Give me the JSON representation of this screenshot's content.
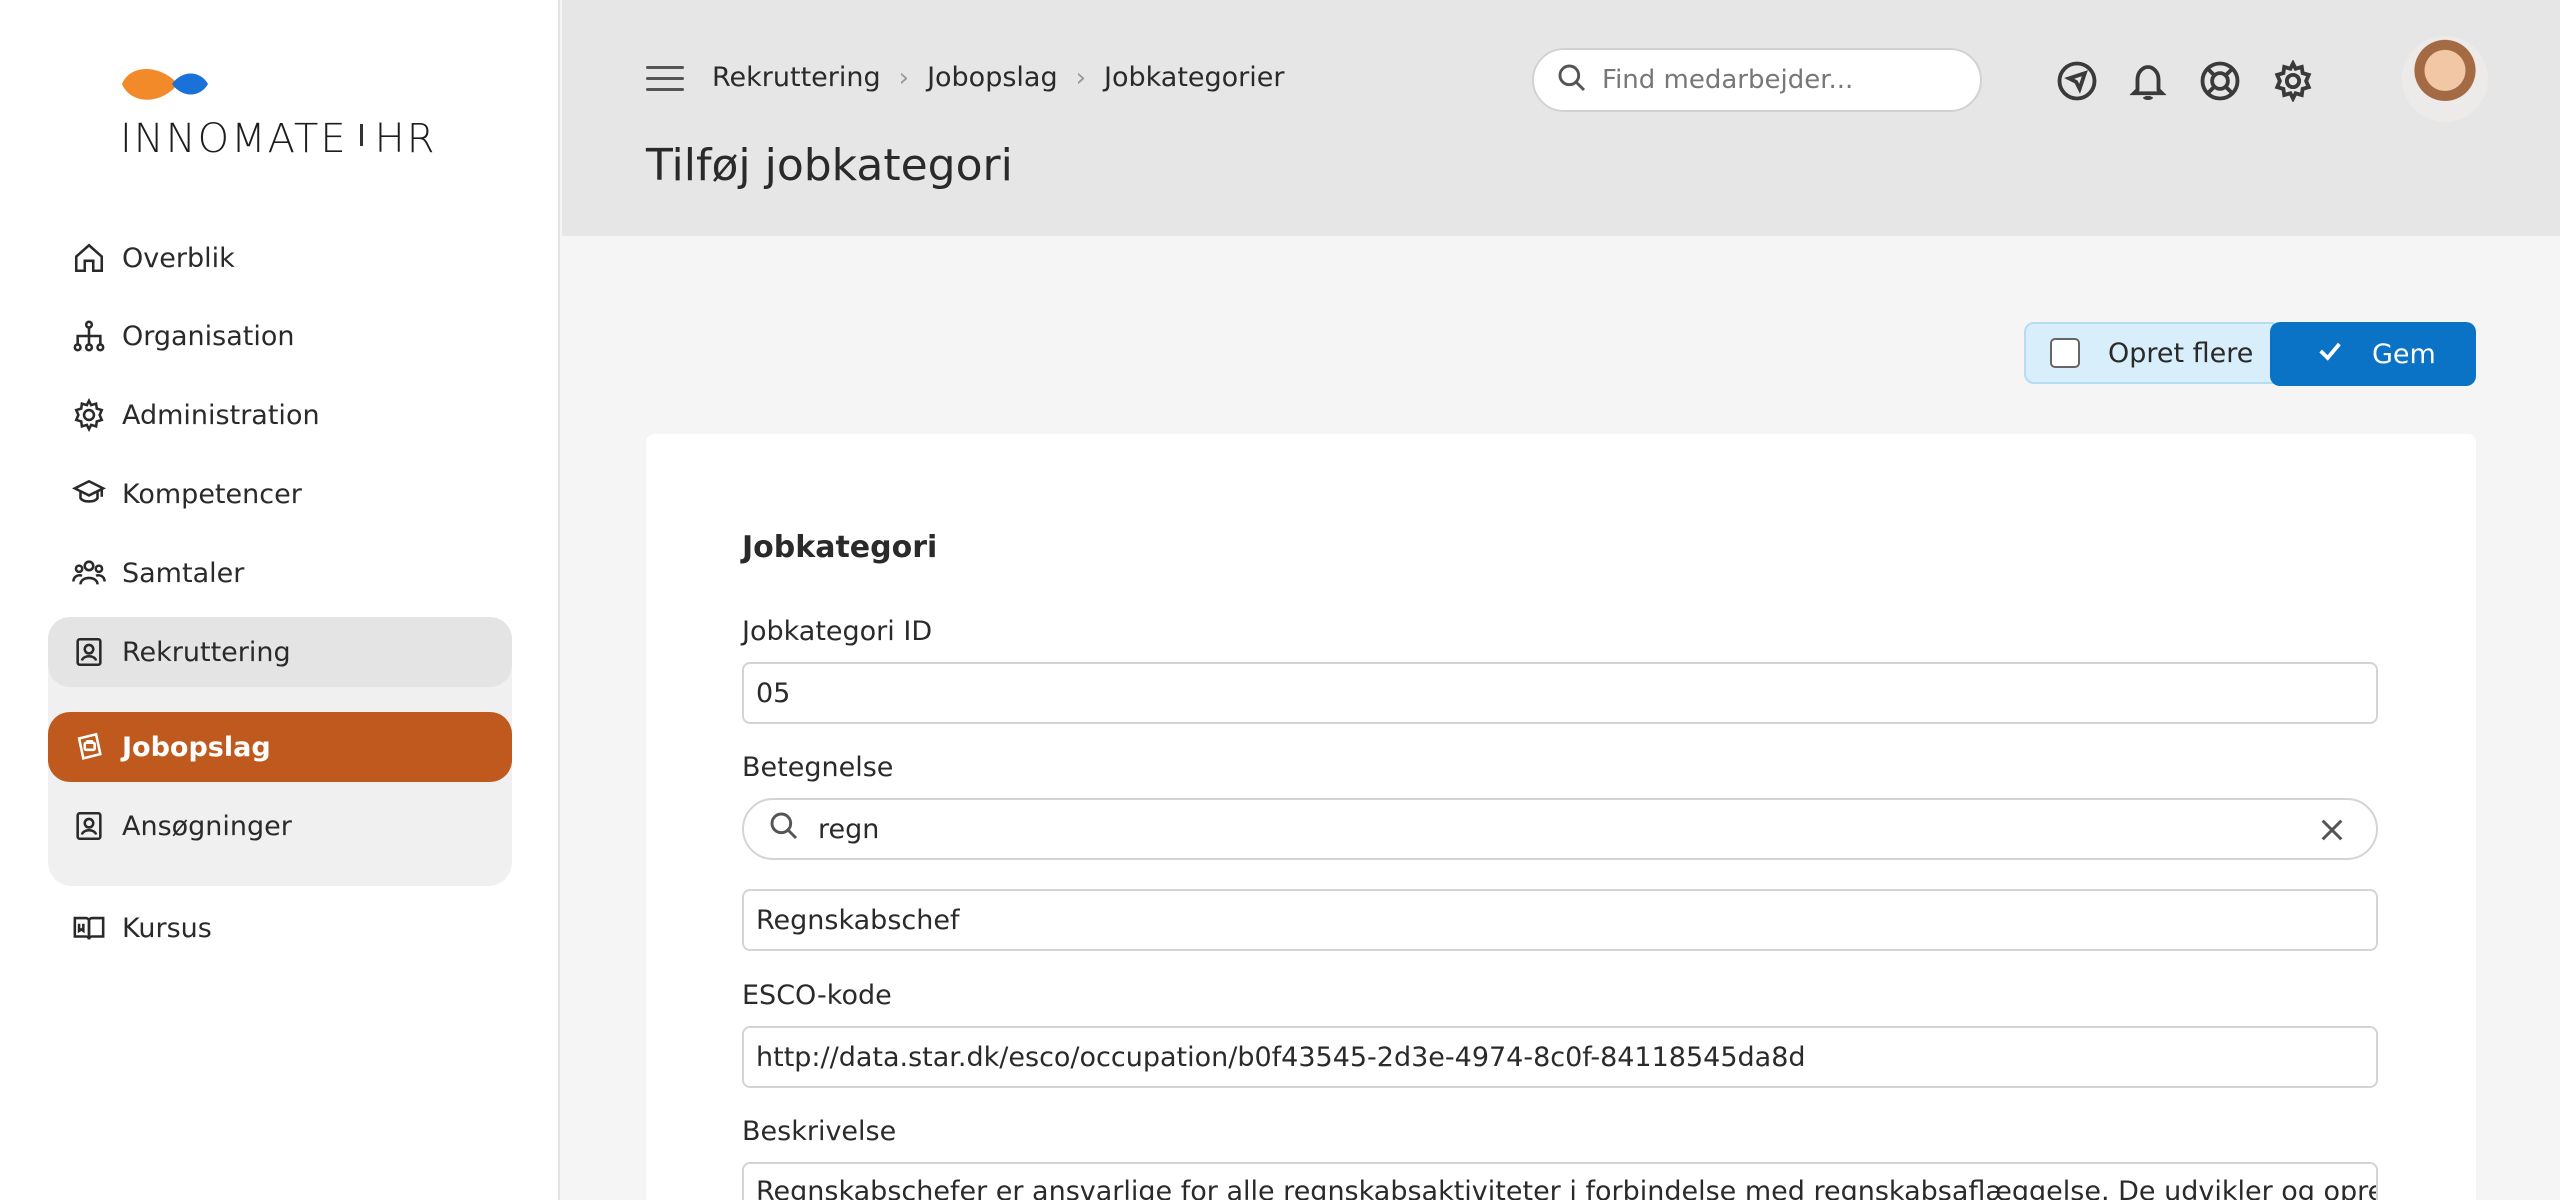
{
  "brand": {
    "name_part1": "INNOMATE",
    "name_part2": "HR",
    "colors": {
      "orange": "#f28a2a",
      "blue": "#1a72d8"
    }
  },
  "sidebar": {
    "items": [
      {
        "label": "Overblik",
        "icon": "home-icon"
      },
      {
        "label": "Organisation",
        "icon": "org-chart-icon"
      },
      {
        "label": "Administration",
        "icon": "gear-icon"
      },
      {
        "label": "Kompetencer",
        "icon": "graduation-cap-icon"
      },
      {
        "label": "Samtaler",
        "icon": "people-icon"
      },
      {
        "label": "Rekruttering",
        "icon": "id-badge-icon"
      },
      {
        "label": "Jobopslag",
        "icon": "job-post-icon"
      },
      {
        "label": "Ansøgninger",
        "icon": "id-badge-icon"
      },
      {
        "label": "Kursus",
        "icon": "book-icon"
      }
    ],
    "active_color": "#c0591e"
  },
  "header": {
    "breadcrumb": [
      "Rekruttering",
      "Jobopslag",
      "Jobkategorier"
    ],
    "page_title": "Tilføj jobkategori",
    "search_placeholder": "Find medarbejder...",
    "icons": [
      "navigation-icon",
      "bell-icon",
      "lifebuoy-icon",
      "gear-icon"
    ]
  },
  "actions": {
    "create_more_label": "Opret flere",
    "save_label": "Gem",
    "primary_color": "#0b73c6"
  },
  "form": {
    "section_title": "Jobkategori",
    "id_label": "Jobkategori ID",
    "id_value": "05",
    "title_label": "Betegnelse",
    "search_value": "regn",
    "selected_title": "Regnskabschef",
    "esco_label": "ESCO-kode",
    "esco_value": "http://data.star.dk/esco/occupation/b0f43545-2d3e-4974-8c0f-84118545da8d",
    "description_label": "Beskrivelse",
    "description_value": "Regnskabschefer er ansvarlige for alle regnskabsaktiviteter i forbindelse med regnskabsaflæggelse. De udvikler og opretholder"
  }
}
